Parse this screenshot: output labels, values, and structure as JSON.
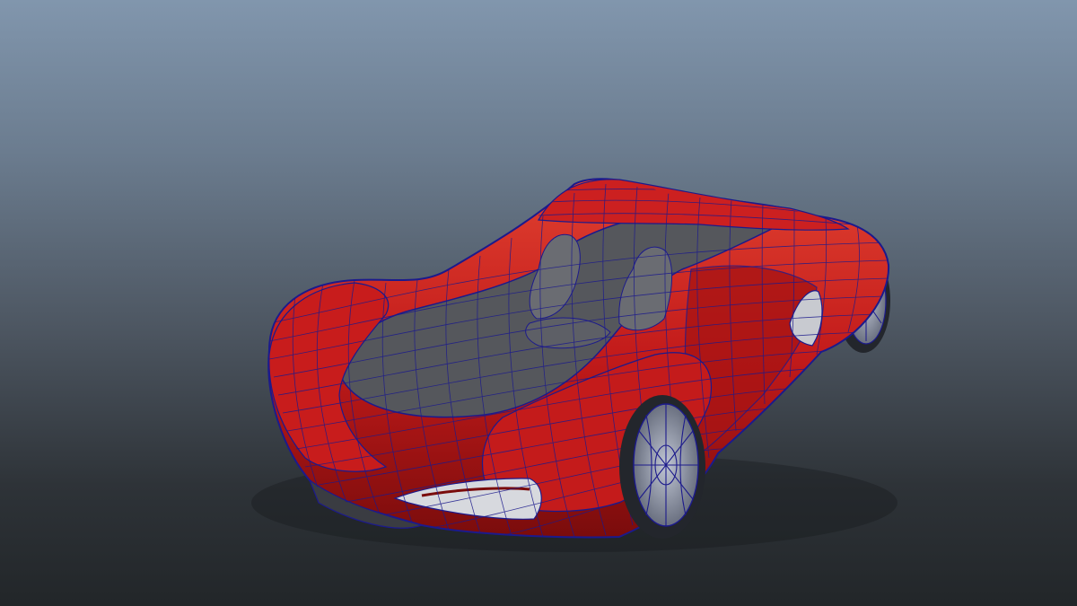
{
  "viewport": {
    "background_top": "#8196ad",
    "background_bottom": "#222629"
  },
  "model": {
    "subject": "sports-car",
    "paint_color": "#c21a1a",
    "paint_highlight": "#e04030",
    "paint_shadow": "#7a0c0c",
    "wireframe_color": "#1c1a8c",
    "glass_color": "#5a5a5e",
    "wheel_color": "#9aa0b0",
    "display_mode": "shaded-with-wireframe"
  }
}
